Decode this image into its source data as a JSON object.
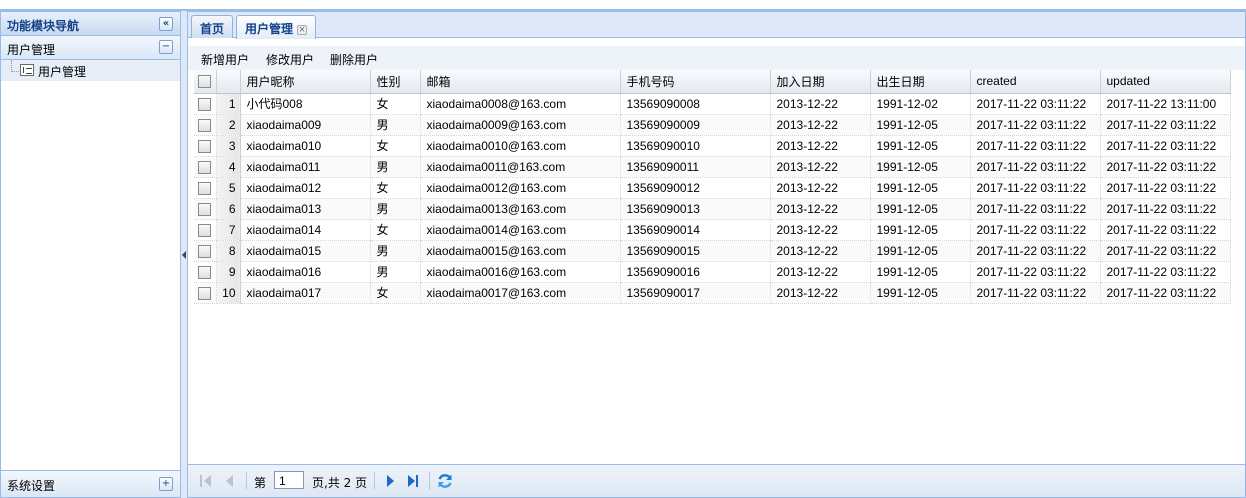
{
  "nav": {
    "title": "功能模块导航",
    "collapse_glyph": "«",
    "sections": [
      {
        "label": "用户管理",
        "toggle": "−",
        "items": [
          {
            "label": "用户管理"
          }
        ]
      },
      {
        "label": "系统设置",
        "toggle": "+"
      }
    ]
  },
  "tabs": [
    {
      "label": "首页"
    },
    {
      "label": "用户管理",
      "close": "×"
    }
  ],
  "toolbar": {
    "add": "新增用户",
    "edit": "修改用户",
    "delete": "删除用户"
  },
  "grid": {
    "columns": [
      "用户昵称",
      "性别",
      "邮箱",
      "手机号码",
      "加入日期",
      "出生日期",
      "created",
      "updated"
    ],
    "rows": [
      {
        "n": "1",
        "nickname": "小代码008",
        "gender": "女",
        "email": "xiaodaima0008@163.com",
        "phone": "13569090008",
        "joined": "2013-12-22",
        "birth": "1991-12-02",
        "created": "2017-11-22 03:11:22",
        "updated": "2017-11-22 13:11:00"
      },
      {
        "n": "2",
        "nickname": "xiaodaima009",
        "gender": "男",
        "email": "xiaodaima0009@163.com",
        "phone": "13569090009",
        "joined": "2013-12-22",
        "birth": "1991-12-05",
        "created": "2017-11-22 03:11:22",
        "updated": "2017-11-22 03:11:22"
      },
      {
        "n": "3",
        "nickname": "xiaodaima010",
        "gender": "女",
        "email": "xiaodaima0010@163.com",
        "phone": "13569090010",
        "joined": "2013-12-22",
        "birth": "1991-12-05",
        "created": "2017-11-22 03:11:22",
        "updated": "2017-11-22 03:11:22"
      },
      {
        "n": "4",
        "nickname": "xiaodaima011",
        "gender": "男",
        "email": "xiaodaima0011@163.com",
        "phone": "13569090011",
        "joined": "2013-12-22",
        "birth": "1991-12-05",
        "created": "2017-11-22 03:11:22",
        "updated": "2017-11-22 03:11:22"
      },
      {
        "n": "5",
        "nickname": "xiaodaima012",
        "gender": "女",
        "email": "xiaodaima0012@163.com",
        "phone": "13569090012",
        "joined": "2013-12-22",
        "birth": "1991-12-05",
        "created": "2017-11-22 03:11:22",
        "updated": "2017-11-22 03:11:22"
      },
      {
        "n": "6",
        "nickname": "xiaodaima013",
        "gender": "男",
        "email": "xiaodaima0013@163.com",
        "phone": "13569090013",
        "joined": "2013-12-22",
        "birth": "1991-12-05",
        "created": "2017-11-22 03:11:22",
        "updated": "2017-11-22 03:11:22"
      },
      {
        "n": "7",
        "nickname": "xiaodaima014",
        "gender": "女",
        "email": "xiaodaima0014@163.com",
        "phone": "13569090014",
        "joined": "2013-12-22",
        "birth": "1991-12-05",
        "created": "2017-11-22 03:11:22",
        "updated": "2017-11-22 03:11:22"
      },
      {
        "n": "8",
        "nickname": "xiaodaima015",
        "gender": "男",
        "email": "xiaodaima0015@163.com",
        "phone": "13569090015",
        "joined": "2013-12-22",
        "birth": "1991-12-05",
        "created": "2017-11-22 03:11:22",
        "updated": "2017-11-22 03:11:22"
      },
      {
        "n": "9",
        "nickname": "xiaodaima016",
        "gender": "男",
        "email": "xiaodaima0016@163.com",
        "phone": "13569090016",
        "joined": "2013-12-22",
        "birth": "1991-12-05",
        "created": "2017-11-22 03:11:22",
        "updated": "2017-11-22 03:11:22"
      },
      {
        "n": "10",
        "nickname": "xiaodaima017",
        "gender": "女",
        "email": "xiaodaima0017@163.com",
        "phone": "13569090017",
        "joined": "2013-12-22",
        "birth": "1991-12-05",
        "created": "2017-11-22 03:11:22",
        "updated": "2017-11-22 03:11:22"
      }
    ]
  },
  "pager": {
    "page_prefix": "第",
    "page_value": "1",
    "page_suffix": "页,共 2 页"
  },
  "colors": {
    "border": "#99bbe8",
    "header_text": "#15428b",
    "accent": "#1a6bc7"
  }
}
